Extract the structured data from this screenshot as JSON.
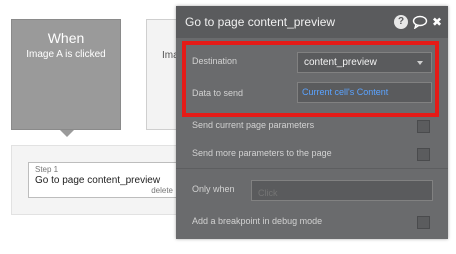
{
  "event": {
    "when_label": "When",
    "condition": "Image A is clicked",
    "second_card_text": "Ima"
  },
  "steps": [
    {
      "number": "Step 1",
      "title": "Go to page content_preview",
      "delete_label": "delete"
    }
  ],
  "palette": {
    "title": "Go to page content_preview",
    "help_icon": "?",
    "comment_icon": "⬭",
    "close_icon": "✖",
    "destination": {
      "label": "Destination",
      "value": "content_preview"
    },
    "data_to_send": {
      "label": "Data to send",
      "value": "Current cell's Content"
    },
    "send_current_params": {
      "label": "Send current page parameters",
      "checked": false
    },
    "send_more_params": {
      "label": "Send more parameters to the page",
      "checked": false
    },
    "only_when": {
      "label": "Only when",
      "placeholder": "Click"
    },
    "breakpoint": {
      "label": "Add a breakpoint in debug mode",
      "checked": false
    }
  },
  "colors": {
    "highlight": "#e41b17",
    "dynamic_text": "#5aa3ff",
    "palette_bg": "#6a6b6d"
  }
}
